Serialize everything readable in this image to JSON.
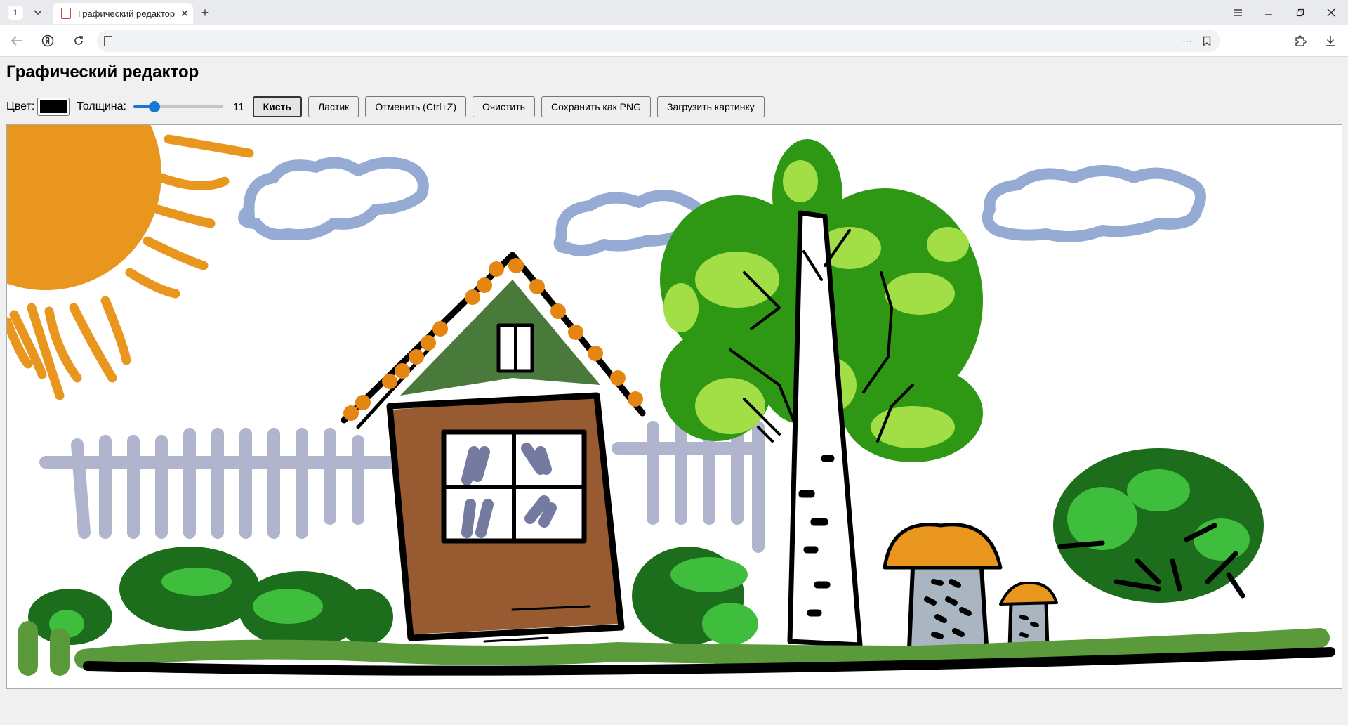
{
  "browser": {
    "tab_count": "1",
    "tab_title": "Графический редактор",
    "window_buttons": [
      "menu-icon",
      "minimize-icon",
      "restore-icon",
      "close-icon"
    ]
  },
  "page": {
    "title": "Графический редактор",
    "toolbar": {
      "color_label": "Цвет:",
      "color_value": "#000000",
      "thickness_label": "Толщина:",
      "thickness_value": "11",
      "thickness_fraction": 0.2,
      "brush_label": "Кисть",
      "eraser_label": "Ластик",
      "undo_label": "Отменить (Ctrl+Z)",
      "clear_label": "Очистить",
      "save_label": "Сохранить как PNG",
      "load_label": "Загрузить картинку",
      "active_tool": "brush"
    }
  },
  "colors": {
    "sun": "#e8961e",
    "cloud": "#95abd4",
    "fence": "#b0b4cc",
    "roof": "#497a3c",
    "tile": "#e58512",
    "wall": "#975a31",
    "glass": "#757aa0",
    "leaf_dark": "#2e9714",
    "leaf_light": "#a2de46",
    "bush_dark": "#1c6d1c",
    "bush_light": "#3fbd3c",
    "grass": "#5a9a3a",
    "mushroom_cap": "#e8961e",
    "mushroom_stem": "#a9b5c0",
    "ink": "#000000"
  }
}
